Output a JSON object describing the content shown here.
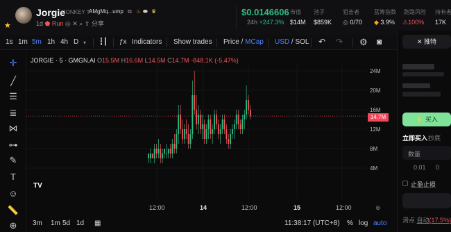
{
  "header": {
    "ticker": "Jorgie",
    "token_name": "MONKEY T",
    "address": "AMgMq...ump",
    "age": "1d",
    "run_label": "Run",
    "share_label": "分享",
    "price": "$0.0146606",
    "period": "24h",
    "change": "+247.3%",
    "stats": [
      {
        "label": "市值",
        "value": "$14M"
      },
      {
        "label": "池子",
        "value": "$859K"
      },
      {
        "label": "狙击者",
        "value": "0/70"
      },
      {
        "label": "蓝筹指数",
        "value": "3.9%"
      },
      {
        "label": "跑路风险",
        "value": "100%"
      },
      {
        "label": "持有者",
        "value": "17K"
      }
    ]
  },
  "toolbar": {
    "intervals": [
      "1s",
      "1m",
      "5m",
      "1h",
      "4h",
      "D"
    ],
    "active_interval": "5m",
    "indicators": "Indicators",
    "show_trades": "Show trades",
    "price_label": "Price",
    "mcap_label": "MCap",
    "usd_label": "USD",
    "sol_label": "SOL"
  },
  "chart_legend": {
    "title": "JORGIE · 5 · GMGN.AI",
    "o_label": "O",
    "o": "15.5M",
    "h_label": "H",
    "h": "16.6M",
    "l_label": "L",
    "l": "14.5M",
    "c_label": "C",
    "c": "14.7M",
    "change": "-848.1K (-5.47%)"
  },
  "chart_data": {
    "type": "candlestick",
    "ylabels": [
      "24M",
      "20M",
      "16M",
      "12M",
      "8M",
      "4M"
    ],
    "yvalues": [
      24,
      20,
      16,
      12,
      8,
      4
    ],
    "ylim": [
      0,
      26
    ],
    "xlabels": [
      "12:00",
      "14",
      "12:00",
      "15",
      "12:00"
    ],
    "current_value": 14.7,
    "current_label": "14.7M",
    "candles": [
      [
        6,
        7,
        5,
        7
      ],
      [
        6,
        8,
        5,
        7
      ],
      [
        7,
        7,
        6,
        6
      ],
      [
        6,
        9,
        5,
        8
      ],
      [
        8,
        9,
        6,
        7
      ],
      [
        7,
        10,
        6,
        8
      ],
      [
        8,
        9,
        5,
        6
      ],
      [
        6,
        8,
        5,
        7
      ],
      [
        7,
        8,
        6,
        8
      ],
      [
        7,
        9,
        6,
        7
      ],
      [
        7,
        8,
        6,
        8
      ],
      [
        8,
        9,
        6,
        7
      ],
      [
        7,
        10,
        6,
        9
      ],
      [
        9,
        11,
        7,
        8
      ],
      [
        8,
        12,
        7,
        11
      ],
      [
        11,
        17,
        9,
        15
      ],
      [
        15,
        17,
        11,
        12
      ],
      [
        12,
        14,
        9,
        10
      ],
      [
        10,
        13,
        9,
        12
      ],
      [
        12,
        14,
        10,
        11
      ],
      [
        11,
        13,
        8,
        9
      ],
      [
        9,
        12,
        8,
        11
      ],
      [
        11,
        22,
        10,
        19
      ],
      [
        19,
        24,
        15,
        16
      ],
      [
        16,
        19,
        12,
        13
      ],
      [
        13,
        17,
        11,
        15
      ],
      [
        15,
        16,
        11,
        12
      ],
      [
        12,
        15,
        10,
        13
      ],
      [
        13,
        14,
        9,
        10
      ],
      [
        10,
        13,
        9,
        12
      ],
      [
        12,
        15,
        10,
        14
      ],
      [
        14,
        15,
        10,
        11
      ],
      [
        11,
        13,
        9,
        12
      ],
      [
        12,
        16,
        11,
        15
      ],
      [
        15,
        16,
        12,
        13
      ],
      [
        13,
        14,
        10,
        11
      ],
      [
        11,
        13,
        9,
        12
      ],
      [
        12,
        15,
        11,
        14
      ],
      [
        14,
        15,
        11,
        12
      ],
      [
        12,
        13,
        9,
        10
      ],
      [
        10,
        11,
        8,
        9
      ],
      [
        9,
        12,
        8,
        11
      ],
      [
        11,
        13,
        10,
        12
      ],
      [
        12,
        14,
        10,
        13
      ],
      [
        13,
        16,
        12,
        15
      ],
      [
        15,
        16,
        12,
        13
      ],
      [
        13,
        14,
        11,
        12
      ],
      [
        12,
        15,
        11,
        14
      ],
      [
        14,
        16,
        12,
        15
      ],
      [
        15,
        21,
        14,
        18
      ],
      [
        18,
        19,
        15,
        16
      ],
      [
        16,
        17,
        14,
        14.7
      ]
    ]
  },
  "bottom": {
    "ranges": [
      "3m",
      "1m",
      "5d",
      "1d"
    ],
    "time": "11:38:17 (UTC+8)",
    "pct": "%",
    "log": "log",
    "auto": "auto"
  },
  "right_panel": {
    "twitter": "推特",
    "buy_label": "买入",
    "tab_buy_now": "立即买入",
    "tab_limit": "抄底",
    "qty_label": "数量",
    "qty_presets": [
      "0.01",
      "0"
    ],
    "stop_label": "止盈止损",
    "slippage_label": "滑点",
    "slippage_mode": "自动",
    "slippage_value": "17.5%"
  }
}
